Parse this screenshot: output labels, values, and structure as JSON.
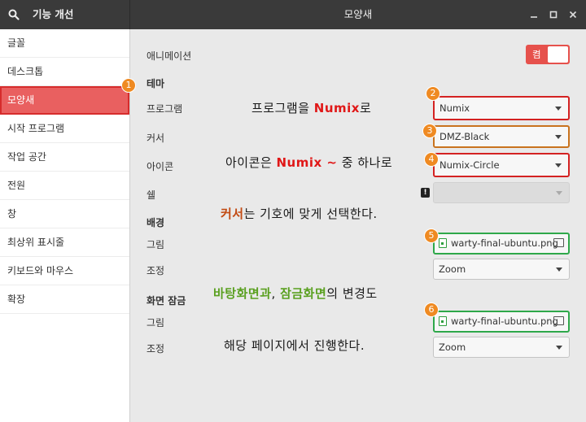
{
  "header": {
    "left_title": "기능 개선",
    "title": "모양새"
  },
  "sidebar": {
    "items": [
      {
        "label": "글꼴"
      },
      {
        "label": "데스크톱"
      },
      {
        "label": "모양새"
      },
      {
        "label": "시작 프로그램"
      },
      {
        "label": "작업 공간"
      },
      {
        "label": "전원"
      },
      {
        "label": "창"
      },
      {
        "label": "최상위 표시줄"
      },
      {
        "label": "키보드와 마우스"
      },
      {
        "label": "확장"
      }
    ],
    "selected": "모양새"
  },
  "main": {
    "animation_label": "애니메이션",
    "animation_toggle": "켬",
    "theme_section": "테마",
    "program_label": "프로그램",
    "program_value": "Numix",
    "cursor_label": "커서",
    "cursor_value": "DMZ-Black",
    "icon_label": "아이콘",
    "icon_value": "Numix-Circle",
    "shell_label": "쉘",
    "shell_value": "",
    "warning_glyph": "!",
    "background_section": "배경",
    "bg_image_label": "그림",
    "bg_image_value": "warty-final-ubuntu.png",
    "bg_adjust_label": "조정",
    "bg_adjust_value": "Zoom",
    "lock_section": "화면 잠금",
    "lock_image_label": "그림",
    "lock_image_value": "warty-final-ubuntu.png",
    "lock_adjust_label": "조정",
    "lock_adjust_value": "Zoom"
  },
  "badges": [
    "1",
    "2",
    "3",
    "4",
    "5",
    "6"
  ],
  "notes": {
    "n1_a": "프로그램을 ",
    "n1_b": "Numix",
    "n1_c": "로",
    "n2_a": "아이콘은 ",
    "n2_b": "Numix ~",
    "n2_c": " 중 하나로",
    "n3_a": "커서",
    "n3_b": "는 기호에 맞게 선택한다.",
    "n4_a": "바탕화면과",
    "n4_b": ", ",
    "n4_c": "잠금화면",
    "n4_d": "의 변경도",
    "n5": "해당 페이지에서 진행한다."
  },
  "colors": {
    "accent": "#e96060",
    "annotation_red": "#d42222",
    "annotation_orange": "#c9731e",
    "annotation_green": "#2ea84a",
    "toggle_on": "#e6514c"
  }
}
